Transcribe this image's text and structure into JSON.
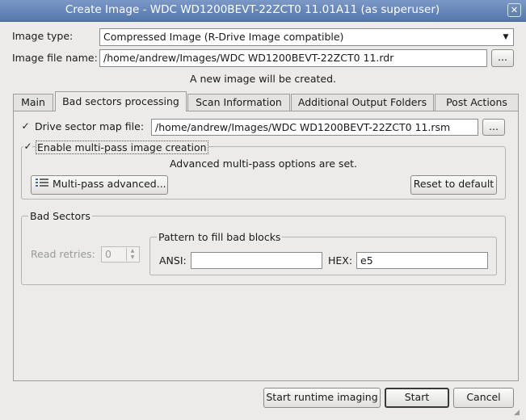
{
  "window": {
    "title": "Create Image - WDC WD1200BEVT-22ZCT0 11.01A11 (as superuser)",
    "close_glyph": "✕"
  },
  "image_type": {
    "label": "Image type:",
    "value": "Compressed Image (R-Drive Image compatible)",
    "arrow": "▼"
  },
  "image_file": {
    "label": "Image file name:",
    "value": "/home/andrew/Images/WDC WD1200BEVT-22ZCT0 11.rdr",
    "browse_label": "..."
  },
  "status_text": "A new image will be created.",
  "tabs": [
    {
      "label": "Main"
    },
    {
      "label": "Bad sectors processing",
      "active": true
    },
    {
      "label": "Scan Information"
    },
    {
      "label": "Additional Output Folders"
    },
    {
      "label": "Post Actions"
    }
  ],
  "sector_map": {
    "checked": true,
    "check_glyph": "✓",
    "label": "Drive sector map file:",
    "value": "/home/andrew/Images/WDC WD1200BEVT-22ZCT0 11.rsm",
    "browse_label": "..."
  },
  "multipass": {
    "checked": true,
    "check_glyph": "✓",
    "label": "Enable multi-pass image creation",
    "info": "Advanced multi-pass options are set.",
    "advanced_button": "Multi-pass advanced...",
    "advanced_icon": "settings-list-icon",
    "reset_button": "Reset to default"
  },
  "bad_sectors": {
    "title": "Bad Sectors",
    "read_retries_label": "Read retries:",
    "read_retries_value": "0",
    "pattern_title": "Pattern to fill bad blocks",
    "ansi_label": "ANSI:",
    "ansi_value": "",
    "hex_label": "HEX:",
    "hex_value": "e5"
  },
  "footer": {
    "runtime_button": "Start runtime imaging",
    "start_button": "Start",
    "cancel_button": "Cancel"
  },
  "colors": {
    "titlebar": "#5f7fb4",
    "window_bg": "#ecebe9"
  }
}
